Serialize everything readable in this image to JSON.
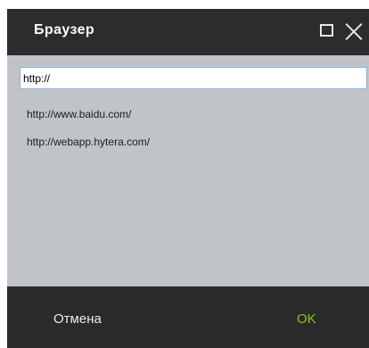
{
  "dialog": {
    "title": "Браузер",
    "icons": {
      "maximize": "maximize-icon",
      "close": "close-icon"
    }
  },
  "url_field": {
    "value": "http://"
  },
  "history": {
    "items": [
      "http://www.baidu.com/",
      "http://webapp.hytera.com/"
    ]
  },
  "footer": {
    "cancel_label": "Отмена",
    "ok_label": "OK"
  },
  "colors": {
    "titlebar_bg": "#2c2c2e",
    "content_bg": "#c0c4c9",
    "footer_bg": "#2a2a2b",
    "ok_accent": "#8fc21f",
    "input_border": "#8ab3d8"
  }
}
